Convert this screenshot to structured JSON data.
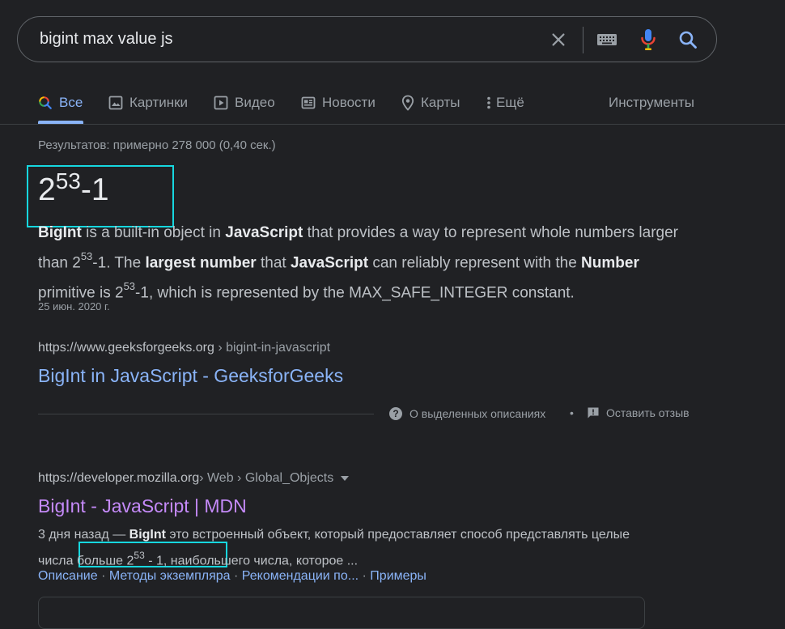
{
  "search": {
    "query": "bigint max value js",
    "icons": [
      "clear-icon",
      "keyboard-icon",
      "microphone-icon",
      "search-icon"
    ]
  },
  "tabs": [
    {
      "label": "Все",
      "icon": "search-icon",
      "active": true
    },
    {
      "label": "Картинки",
      "icon": "image-icon"
    },
    {
      "label": "Видео",
      "icon": "play-icon"
    },
    {
      "label": "Новости",
      "icon": "news-icon"
    },
    {
      "label": "Карты",
      "icon": "map-pin-icon"
    },
    {
      "label": "Ещё",
      "icon": "more-vert-icon"
    }
  ],
  "tools_label": "Инструменты",
  "stats": "Результатов: примерно 278 000 (0,40 сек.)",
  "featured": {
    "answer_base": "2",
    "answer_exp": "53",
    "answer_tail": "-1",
    "snippet": {
      "s1": "BigInt",
      "s2": " is a built-in object in ",
      "s3": "JavaScript",
      "s4": " that provides a way to represent whole numbers larger than 2",
      "s5": "53",
      "s6": "-1. The ",
      "s7": "largest number",
      "s8": " that ",
      "s9": "JavaScript",
      "s10": " can reliably represent with the ",
      "s11": "Number",
      "s12": " primitive is 2",
      "s13": "53",
      "s14": "-1, which is represented by the MAX_SAFE_INTEGER constant."
    },
    "date": "25 июн. 2020 г."
  },
  "result1": {
    "url": "https://www.geeksforgeeks.org",
    "path": " › bigint-in-javascript",
    "title": "BigInt in JavaScript - GeeksforGeeks"
  },
  "feedback": {
    "about_label": "О выделенных описаниях",
    "separator": "•",
    "feedback_label": "Оставить отзыв"
  },
  "result2": {
    "url": "https://developer.mozilla.org",
    "path": " › Web › Global_Objects",
    "title": "BigInt - JavaScript | MDN",
    "snippet": {
      "s1": "3 дня назад — ",
      "s2": "BigInt",
      "s3": " это встроенный объект, который предоставляет способ представлять целые ",
      "s4": "числа больше 2",
      "s5": "53",
      "s6": " - 1",
      "s7": ",",
      "s8": " наибольшего числа, которое ..."
    },
    "sitelinks": [
      "Описание",
      "Методы экземпляра",
      "Рекомендации по...",
      "Примеры"
    ],
    "sitelink_separator": " · "
  },
  "colors": {
    "background": "#202124",
    "link_blue": "#8ab4f8",
    "visited_purple": "#c58af9",
    "highlight_cyan": "#16d7df"
  }
}
